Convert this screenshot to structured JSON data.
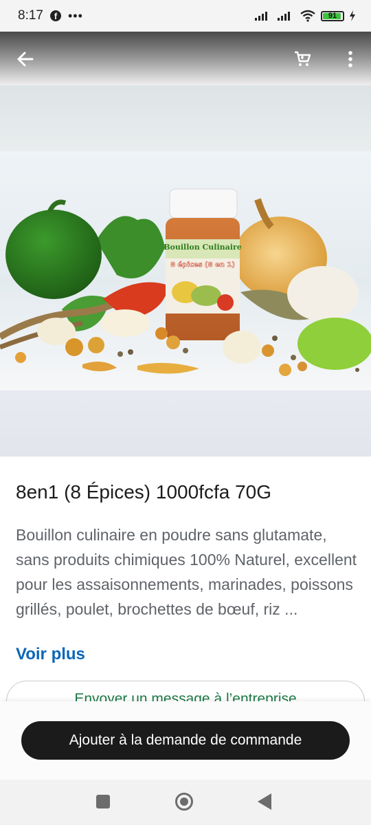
{
  "status_bar": {
    "time": "8:17",
    "overflow_indicator": "•••",
    "battery_level": "91",
    "icons": [
      "facebook-icon",
      "signal-icon",
      "signal-icon",
      "wifi-icon",
      "battery-icon",
      "charging-icon"
    ]
  },
  "header": {
    "icons": [
      "back-arrow-icon",
      "cart-icon",
      "more-vertical-icon"
    ]
  },
  "product": {
    "title": "8en1 (8 Épices) 1000fcfa 70G",
    "description": "Bouillon culinaire en poudre sans glutamate, sans produits chimiques 100% Naturel, excellent pour les assaisonnements, marinades, poissons grillés, poulet, brochettes de bœuf, riz ...",
    "see_more_label": "Voir plus",
    "jar_label_line1": "Bouillon Culinaire",
    "jar_label_line2": "8 épices (8 en 1)"
  },
  "actions": {
    "message_label": "Envoyer un message à l’entreprise",
    "order_label": "Ajouter à la demande de commande"
  },
  "navigation": {
    "icons": [
      "recents-square-icon",
      "home-circle-icon",
      "back-triangle-icon"
    ]
  },
  "colors": {
    "link": "#0a66b7",
    "order_button": "#1b1b1b",
    "message_text": "#1d7a45"
  }
}
